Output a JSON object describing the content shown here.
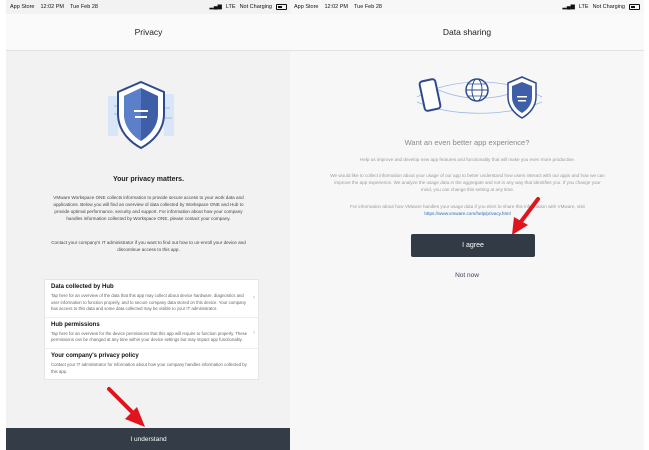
{
  "left": {
    "status": {
      "app": "App Store",
      "time": "12:02 PM",
      "date": "Tue Feb 28",
      "network": "LTE",
      "charging": "Not Charging"
    },
    "title": "Privacy",
    "heading": "Your privacy matters.",
    "intro": "VMware Workspace ONE collects information to provide secure access to your work data and applications. Below you will find an overview of data collected by Workspace ONE and Hub to provide optimal performance, security and support. For information about how your company handles information collected by Workspace ONE, please contact your company.",
    "contact": "Contact your company's IT administrator if you want to find out how to un-enroll your device and discontinue access to this app.",
    "items": [
      {
        "title": "Data collected by Hub",
        "desc": "Tap here for an overview of the data that this app may collect about device hardware, diagnostics and user information to function properly, and to secure company data stored on this device. Your company has access to this data and some data collected may be visible to your IT administrator."
      },
      {
        "title": "Hub permissions",
        "desc": "Tap here for an overview for the device permissions that this app will require to function properly. These permissions can be changed at any time within your device settings but may impact app functionality."
      },
      {
        "title": "Your company's privacy policy",
        "desc": "Contact your IT administrator for information about how your company handles information collected by this app."
      }
    ],
    "button": "I understand"
  },
  "right": {
    "status": {
      "app": "App Store",
      "time": "12:02 PM",
      "date": "Tue Feb 28",
      "network": "LTE",
      "charging": "Not Charging"
    },
    "title": "Data sharing",
    "heading": "Want an even better app experience?",
    "p1": "Help us improve and develop new app features and functionality that will make you even more productive.",
    "p2": "We would like to collect information about your usage of our app to better understand how users interact with our apps and how we can improve the app experience. We analyze the usage data in the aggregate and not in any way that identifies you. If you change your mind, you can change this setting at any time.",
    "p3_pre": "For information about how VMware handles your usage data if you elect to share this information with VMware, visit",
    "p3_link": "https://www.vmware.com/help/privacy.html",
    "agree": "I agree",
    "notnow": "Not now"
  },
  "colors": {
    "button_bg": "#333c47",
    "arrow": "#e0141c",
    "shield": "#2f4a8c"
  },
  "icons": [
    "shield-icon",
    "phone-icon",
    "globe-icon",
    "chevron-right-icon",
    "battery-icon",
    "signal-icon"
  ]
}
